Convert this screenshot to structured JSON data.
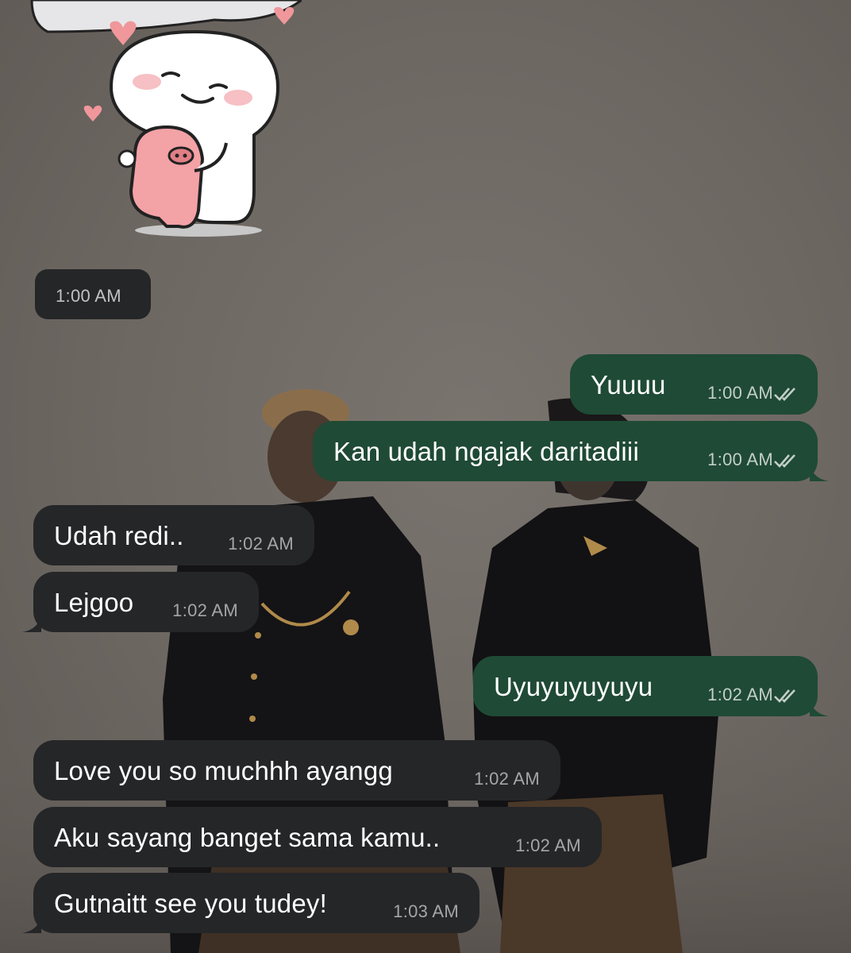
{
  "chat": {
    "colors": {
      "incoming_bubble": "#252628",
      "outgoing_bubble": "#1f4a36",
      "text": "#ffffff",
      "timestamp": "#a4a6aa",
      "read_ticks": "#c3cfc8"
    },
    "sticker": {
      "icon": "hugging-pig-sticker",
      "time": "1:00 AM"
    },
    "messages": [
      {
        "direction": "outgoing",
        "text": "Yuuuu",
        "time": "1:00 AM",
        "status": "read"
      },
      {
        "direction": "outgoing",
        "text": "Kan udah ngajak daritadiii",
        "time": "1:00 AM",
        "status": "read"
      },
      {
        "direction": "incoming",
        "text": "Udah redi..",
        "time": "1:02 AM"
      },
      {
        "direction": "incoming",
        "text": "Lejgoo",
        "time": "1:02 AM"
      },
      {
        "direction": "outgoing",
        "text": "Uyuyuyuyuyu",
        "time": "1:02 AM",
        "status": "read"
      },
      {
        "direction": "incoming",
        "text": "Love you so muchhh ayangg",
        "time": "1:02 AM"
      },
      {
        "direction": "incoming",
        "text": "Aku sayang banget sama kamu..",
        "time": "1:02 AM"
      },
      {
        "direction": "incoming",
        "text": "Gutnaitt see you tudey!",
        "time": "1:03 AM"
      }
    ]
  }
}
